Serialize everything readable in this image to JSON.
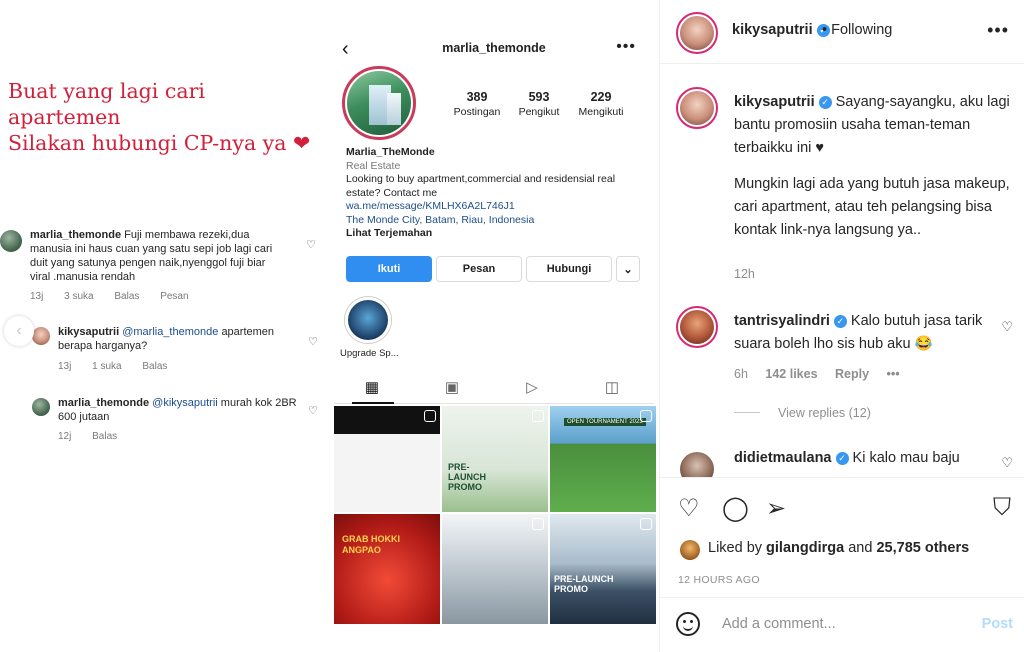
{
  "media": {
    "headline_line1": "Buat yang lagi cari apartemen",
    "headline_line2": "Silakan hubungi CP-nya ya",
    "headline_heart": "❤",
    "comments": [
      {
        "user": "marlia_themonde",
        "text": "Fuji membawa rezeki,dua manusia ini haus cuan yang satu sepi job lagi cari duit yang satunya pengen naik,nyenggol fuji biar viral .manusia rendah",
        "time": "13j",
        "likes": "3 suka",
        "reply": "Balas",
        "extra": "Pesan"
      },
      {
        "user": "kikysaputrii",
        "mention": "@marlia_themonde",
        "text": "apartemen berapa harganya?",
        "time": "13j",
        "likes": "1 suka",
        "reply": "Balas"
      },
      {
        "user": "marlia_themonde",
        "mention": "@kikysaputrii",
        "text": "murah kok 2BR 600 jutaan",
        "time": "12j",
        "reply": "Balas"
      }
    ],
    "nav_prev": "‹",
    "nav_next": "›",
    "profile": {
      "username": "marlia_themonde",
      "back": "‹",
      "more": "•••",
      "stats": [
        {
          "value": "389",
          "label": "Postingan"
        },
        {
          "value": "593",
          "label": "Pengikut"
        },
        {
          "value": "229",
          "label": "Mengikuti"
        }
      ],
      "name": "Marlia_TheMonde",
      "category": "Real Estate",
      "bio": "Looking to buy apartment,commercial and residensial real estate? Contact me",
      "link": "wa.me/message/KMLHX6A2L746J1",
      "location": "The Monde City, Batam, Riau, Indonesia",
      "translate": "Lihat Terjemahan",
      "buttons": {
        "follow": "Ikuti",
        "message": "Pesan",
        "contact": "Hubungi",
        "dropdown": "⌄"
      },
      "highlight_label": "Upgrade Sp...",
      "grid_texts": {
        "promo": "PRE-\nLAUNCH\nPROMO",
        "tournament": "OPEN TOURNAMENT 2023",
        "angpao": "GRAB HOKKI\nANGPAO",
        "promo2": "PRE-LAUNCH\nPROMO"
      }
    }
  },
  "post": {
    "author": "kikysaputrii",
    "following": "Following",
    "more": "•••",
    "verified_glyph": "✓",
    "caption_user": "kikysaputrii",
    "caption_text": "Sayang-sayangku, aku lagi bantu promosiin usaha teman-teman terbaikku ini ♥",
    "caption_text2": "Mungkin lagi ada yang butuh jasa makeup, cari apartment, atau teh pelangsing bisa kontak link-nya langsung ya..",
    "caption_time": "12h",
    "comments": [
      {
        "user": "tantrisyalindri",
        "text": "Kalo butuh jasa tarik suara boleh lho sis hub aku 😂",
        "time": "6h",
        "likes": "142 likes",
        "reply": "Reply",
        "more": "•••"
      },
      {
        "user": "didietmaulana",
        "text": "Ki kalo mau baju"
      }
    ],
    "view_replies": "View replies (12)",
    "liked_by_prefix": "Liked by",
    "liked_by_user": "gilangdirga",
    "liked_by_and": "and",
    "liked_by_count": "25,785 others",
    "date": "12 HOURS AGO",
    "add_comment_placeholder": "Add a comment...",
    "post_button": "Post"
  }
}
